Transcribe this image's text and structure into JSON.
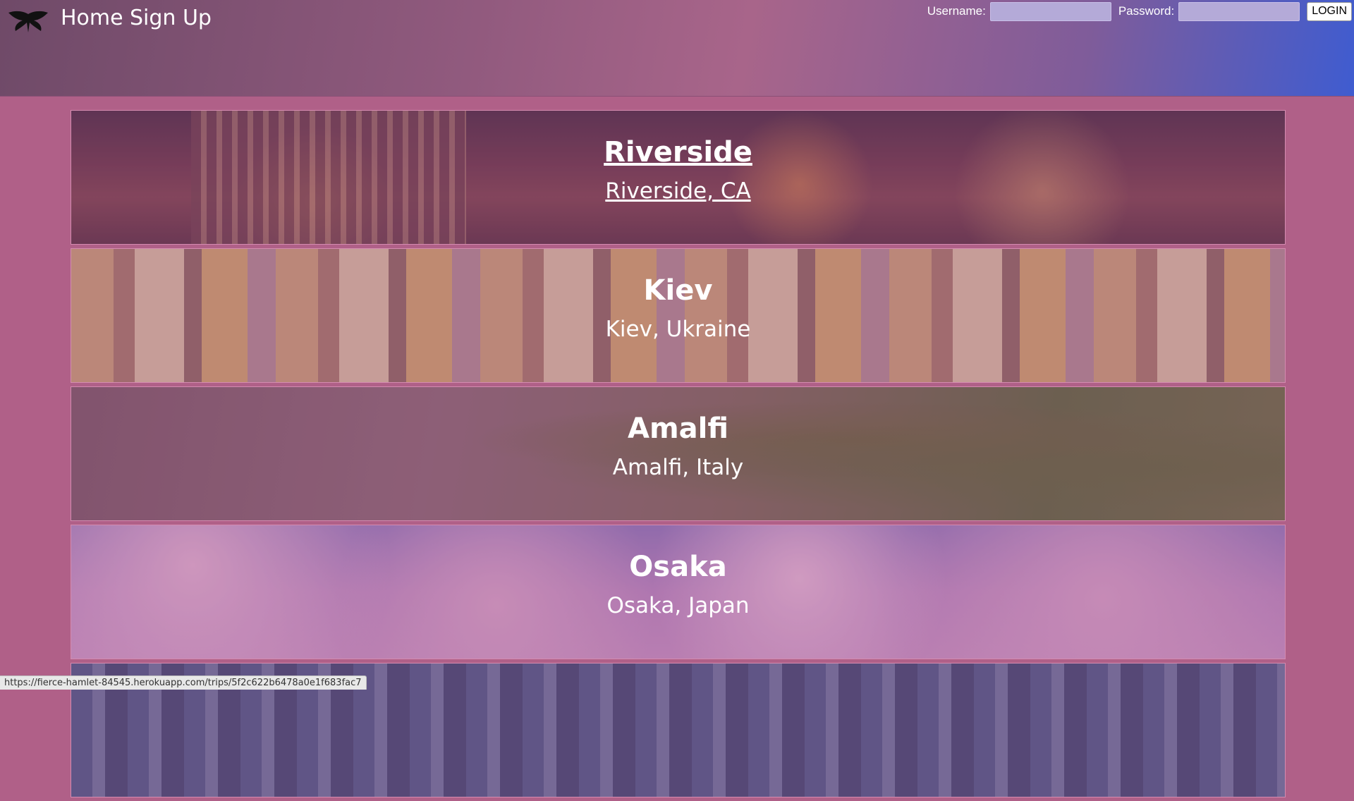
{
  "nav": {
    "home": "Home",
    "signup": "Sign Up",
    "logo_icon": "moth-icon"
  },
  "login": {
    "username_label": "Username:",
    "password_label": "Password:",
    "username_value": "",
    "password_value": "",
    "button": "LOGIN"
  },
  "trips": [
    {
      "title": "Riverside",
      "location": "Riverside, CA"
    },
    {
      "title": "Kiev",
      "location": "Kiev, Ukraine"
    },
    {
      "title": "Amalfi",
      "location": "Amalfi, Italy"
    },
    {
      "title": "Osaka",
      "location": "Osaka, Japan"
    },
    {
      "title": "",
      "location": ""
    }
  ],
  "status_url": "https://fierce-hamlet-84545.herokuapp.com/trips/5f2c622b6478a0e1f683fac7",
  "colors": {
    "page_background": "#b06088",
    "nav_gradient_end": "#3f5cd0"
  }
}
